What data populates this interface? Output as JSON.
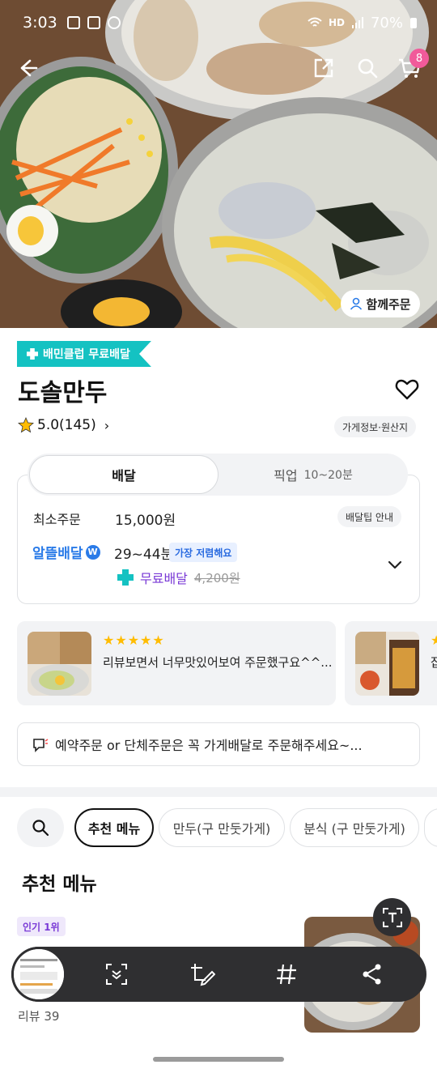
{
  "status_bar": {
    "time": "3:03",
    "network": "HD",
    "battery": "70%"
  },
  "hero": {
    "cart_count": "8",
    "group_order_label": "함께주문",
    "icons": [
      "back-arrow-icon",
      "share-icon",
      "search-icon",
      "cart-icon"
    ]
  },
  "store": {
    "club_badge": "배민클럽 무료배달",
    "name": "도솔만두",
    "rating": "5.0(145)",
    "info_chip": "가게정보·원산지"
  },
  "delivery": {
    "tabs": {
      "delivery": "배달",
      "pickup": "픽업",
      "pickup_time": "10~20분"
    },
    "min_order_label": "최소주문",
    "min_order_value": "15,000원",
    "tip_chip": "배달팁 안내",
    "albtl_label": "알뜰배달",
    "albtl_time": "29~44분",
    "cheapest_badge": "가장 저렴해요",
    "free_label": "무료배달",
    "original_fee": "4,200원"
  },
  "reviews": [
    {
      "stars": "★★★★★",
      "text": "리뷰보면서 너무맛있어보여 주문했구요^^..."
    },
    {
      "stars": "★",
      "text": "잡"
    }
  ],
  "notice": {
    "text": "예약주문 or  단체주문은 꼭 가게배달로 주문해주세요~..."
  },
  "menu_filter": {
    "categories": [
      "추천 메뉴",
      "만두(구 만둣가게)",
      "분식 (구 만둣가게)"
    ]
  },
  "recommended": {
    "title": "추천 메뉴",
    "item": {
      "badge": "인기 1위",
      "review": "리뷰 39"
    }
  },
  "colors": {
    "mint": "#14c2c2",
    "purple": "#7a3ad6",
    "blue": "#2a7be8",
    "star": "#ffbc00",
    "badge_pink": "#f15a9a"
  }
}
